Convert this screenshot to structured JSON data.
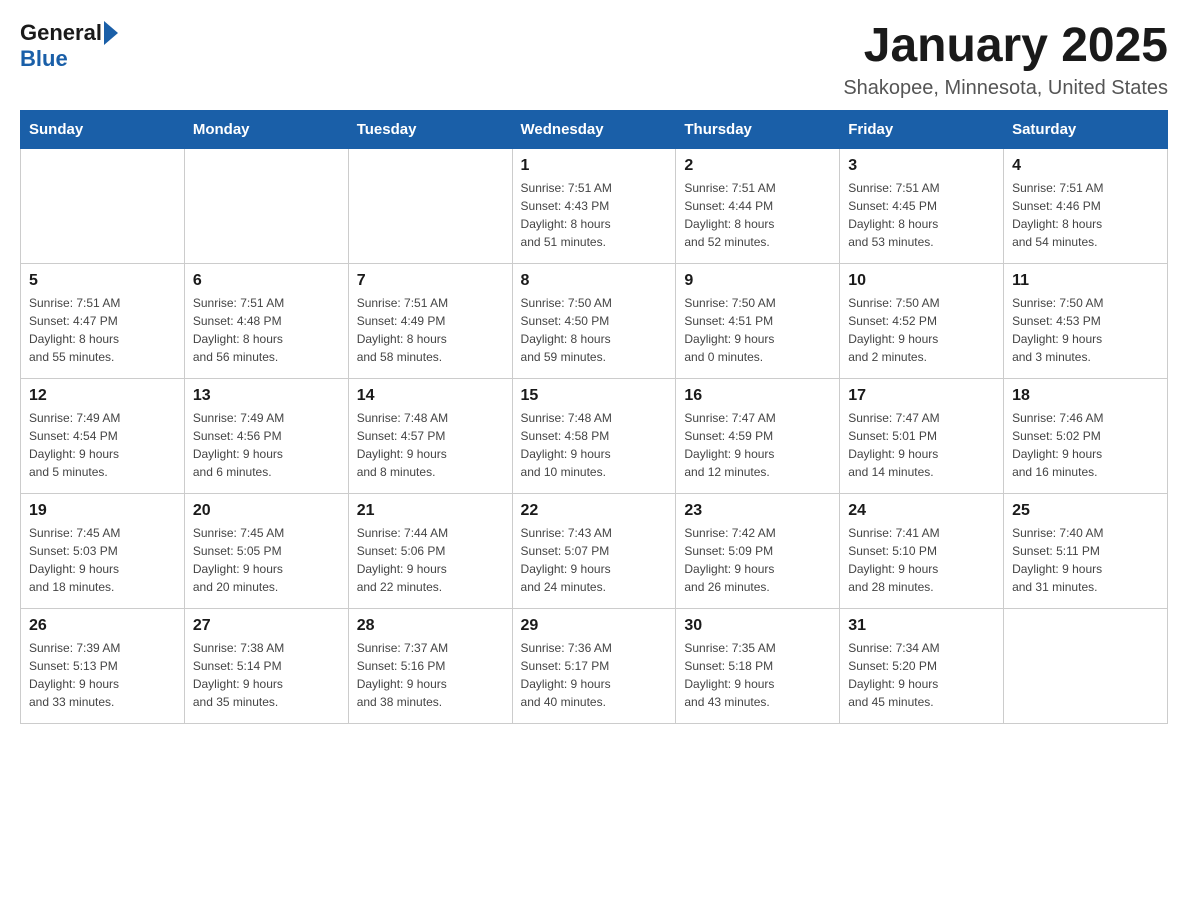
{
  "header": {
    "logo_general": "General",
    "logo_blue": "Blue",
    "month_title": "January 2025",
    "location": "Shakopee, Minnesota, United States"
  },
  "weekdays": [
    "Sunday",
    "Monday",
    "Tuesday",
    "Wednesday",
    "Thursday",
    "Friday",
    "Saturday"
  ],
  "weeks": [
    [
      {
        "day": "",
        "info": ""
      },
      {
        "day": "",
        "info": ""
      },
      {
        "day": "",
        "info": ""
      },
      {
        "day": "1",
        "info": "Sunrise: 7:51 AM\nSunset: 4:43 PM\nDaylight: 8 hours\nand 51 minutes."
      },
      {
        "day": "2",
        "info": "Sunrise: 7:51 AM\nSunset: 4:44 PM\nDaylight: 8 hours\nand 52 minutes."
      },
      {
        "day": "3",
        "info": "Sunrise: 7:51 AM\nSunset: 4:45 PM\nDaylight: 8 hours\nand 53 minutes."
      },
      {
        "day": "4",
        "info": "Sunrise: 7:51 AM\nSunset: 4:46 PM\nDaylight: 8 hours\nand 54 minutes."
      }
    ],
    [
      {
        "day": "5",
        "info": "Sunrise: 7:51 AM\nSunset: 4:47 PM\nDaylight: 8 hours\nand 55 minutes."
      },
      {
        "day": "6",
        "info": "Sunrise: 7:51 AM\nSunset: 4:48 PM\nDaylight: 8 hours\nand 56 minutes."
      },
      {
        "day": "7",
        "info": "Sunrise: 7:51 AM\nSunset: 4:49 PM\nDaylight: 8 hours\nand 58 minutes."
      },
      {
        "day": "8",
        "info": "Sunrise: 7:50 AM\nSunset: 4:50 PM\nDaylight: 8 hours\nand 59 minutes."
      },
      {
        "day": "9",
        "info": "Sunrise: 7:50 AM\nSunset: 4:51 PM\nDaylight: 9 hours\nand 0 minutes."
      },
      {
        "day": "10",
        "info": "Sunrise: 7:50 AM\nSunset: 4:52 PM\nDaylight: 9 hours\nand 2 minutes."
      },
      {
        "day": "11",
        "info": "Sunrise: 7:50 AM\nSunset: 4:53 PM\nDaylight: 9 hours\nand 3 minutes."
      }
    ],
    [
      {
        "day": "12",
        "info": "Sunrise: 7:49 AM\nSunset: 4:54 PM\nDaylight: 9 hours\nand 5 minutes."
      },
      {
        "day": "13",
        "info": "Sunrise: 7:49 AM\nSunset: 4:56 PM\nDaylight: 9 hours\nand 6 minutes."
      },
      {
        "day": "14",
        "info": "Sunrise: 7:48 AM\nSunset: 4:57 PM\nDaylight: 9 hours\nand 8 minutes."
      },
      {
        "day": "15",
        "info": "Sunrise: 7:48 AM\nSunset: 4:58 PM\nDaylight: 9 hours\nand 10 minutes."
      },
      {
        "day": "16",
        "info": "Sunrise: 7:47 AM\nSunset: 4:59 PM\nDaylight: 9 hours\nand 12 minutes."
      },
      {
        "day": "17",
        "info": "Sunrise: 7:47 AM\nSunset: 5:01 PM\nDaylight: 9 hours\nand 14 minutes."
      },
      {
        "day": "18",
        "info": "Sunrise: 7:46 AM\nSunset: 5:02 PM\nDaylight: 9 hours\nand 16 minutes."
      }
    ],
    [
      {
        "day": "19",
        "info": "Sunrise: 7:45 AM\nSunset: 5:03 PM\nDaylight: 9 hours\nand 18 minutes."
      },
      {
        "day": "20",
        "info": "Sunrise: 7:45 AM\nSunset: 5:05 PM\nDaylight: 9 hours\nand 20 minutes."
      },
      {
        "day": "21",
        "info": "Sunrise: 7:44 AM\nSunset: 5:06 PM\nDaylight: 9 hours\nand 22 minutes."
      },
      {
        "day": "22",
        "info": "Sunrise: 7:43 AM\nSunset: 5:07 PM\nDaylight: 9 hours\nand 24 minutes."
      },
      {
        "day": "23",
        "info": "Sunrise: 7:42 AM\nSunset: 5:09 PM\nDaylight: 9 hours\nand 26 minutes."
      },
      {
        "day": "24",
        "info": "Sunrise: 7:41 AM\nSunset: 5:10 PM\nDaylight: 9 hours\nand 28 minutes."
      },
      {
        "day": "25",
        "info": "Sunrise: 7:40 AM\nSunset: 5:11 PM\nDaylight: 9 hours\nand 31 minutes."
      }
    ],
    [
      {
        "day": "26",
        "info": "Sunrise: 7:39 AM\nSunset: 5:13 PM\nDaylight: 9 hours\nand 33 minutes."
      },
      {
        "day": "27",
        "info": "Sunrise: 7:38 AM\nSunset: 5:14 PM\nDaylight: 9 hours\nand 35 minutes."
      },
      {
        "day": "28",
        "info": "Sunrise: 7:37 AM\nSunset: 5:16 PM\nDaylight: 9 hours\nand 38 minutes."
      },
      {
        "day": "29",
        "info": "Sunrise: 7:36 AM\nSunset: 5:17 PM\nDaylight: 9 hours\nand 40 minutes."
      },
      {
        "day": "30",
        "info": "Sunrise: 7:35 AM\nSunset: 5:18 PM\nDaylight: 9 hours\nand 43 minutes."
      },
      {
        "day": "31",
        "info": "Sunrise: 7:34 AM\nSunset: 5:20 PM\nDaylight: 9 hours\nand 45 minutes."
      },
      {
        "day": "",
        "info": ""
      }
    ]
  ]
}
